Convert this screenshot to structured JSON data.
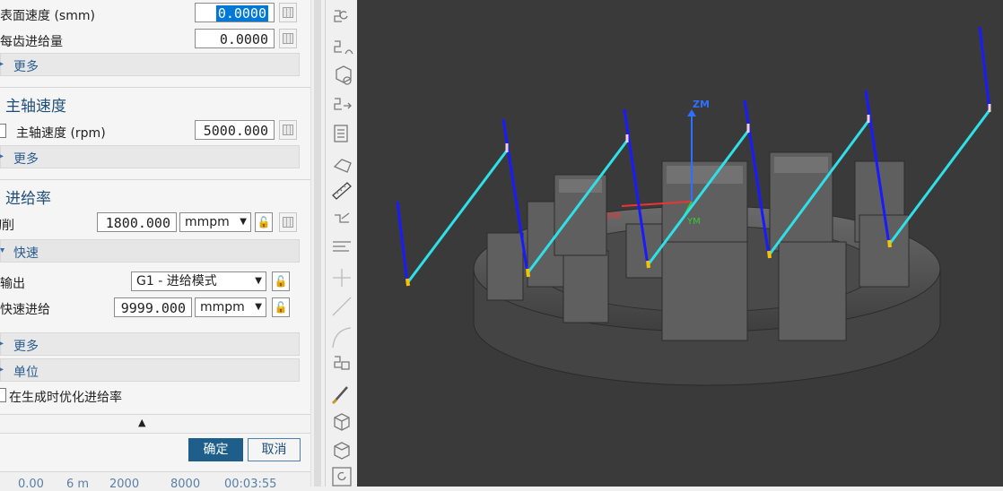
{
  "feed_section": {
    "surface_speed_label": "表面速度 (smm)",
    "surface_speed_value": "0.0000",
    "feed_per_tooth_label": "每齿进给量",
    "feed_per_tooth_value": "0.0000",
    "more_label": "更多"
  },
  "spindle": {
    "title": "主轴速度",
    "speed_label": "主轴速度 (rpm)",
    "speed_value": "5000.000",
    "more_label": "更多"
  },
  "feedrate": {
    "title": "进给率",
    "cut_label": "切削",
    "cut_value": "1800.000",
    "cut_unit": "mmpm",
    "rapid_title": "快速",
    "output_label": "输出",
    "output_value": "G1 - 进给模式",
    "rapid_feed_label": "快速进给",
    "rapid_feed_value": "9999.000",
    "rapid_unit": "mmpm",
    "more_label": "更多",
    "units_label": "单位",
    "optimize_label": "在生成时优化进给率"
  },
  "buttons": {
    "ok": "确定",
    "cancel": "取消"
  },
  "status_row": [
    "0.00",
    "6 m",
    "2000",
    "8000",
    "00:03:55"
  ],
  "colors": {
    "viewport_bg": "#3a3a3a",
    "ok_button": "#1d5f8a",
    "cutter_path": "#2fe0e8",
    "engage_line": "#1a1aff",
    "axis_z": "#2f6fff",
    "axis_x": "#e33"
  },
  "viewport": {
    "axis_z_label": "ZM",
    "axis_x_label": "XM",
    "axis_y_label": "YM"
  },
  "toolbar_icons": [
    "path-rotate-icon",
    "path-reverse-icon",
    "gear-check-icon",
    "path-export-icon",
    "document-icon",
    "shape-orient-icon",
    "ruler-icon",
    "toolpath-edit-icon",
    "feed-lines-icon",
    "plus-icon",
    "line-icon",
    "arc-icon",
    "path-split-icon",
    "brush-icon",
    "cube-icon",
    "cube-edit-icon",
    "refresh-icon"
  ]
}
